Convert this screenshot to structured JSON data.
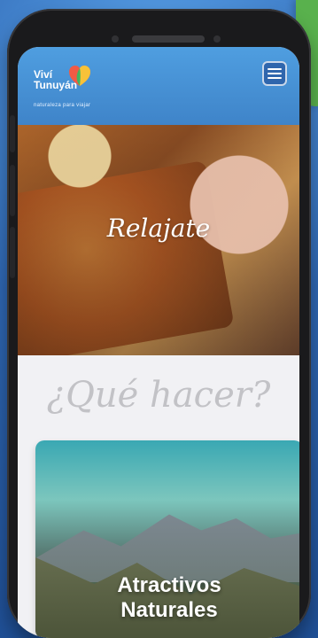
{
  "logo": {
    "line1": "Viví",
    "line2": "Tunuyán",
    "tagline": "naturaleza para viajar"
  },
  "hero": {
    "title": "Relajate"
  },
  "section": {
    "title": "¿Qué hacer?"
  },
  "card": {
    "title_line1": "Atractivos",
    "title_line2": "Naturales"
  },
  "colors": {
    "header_blue": "#4f9ee0",
    "menu_blue": "#2f66ad",
    "background_blue": "#2f67b3",
    "accent_green": "#59b14d"
  },
  "icons": {
    "menu": "hamburger-menu-icon",
    "logo_mark": "heart-logo-icon"
  }
}
